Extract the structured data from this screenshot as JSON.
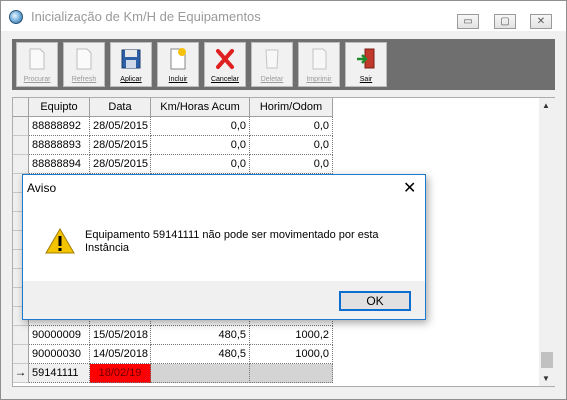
{
  "window": {
    "title": "Inicialização de Km/H de Equipamentos",
    "minimize": "▭",
    "restore": "▢",
    "close": "✕"
  },
  "toolbar": {
    "procurar": "Procurar",
    "refresh": "Refresh",
    "aplicar": "Aplicar",
    "incluir": "Incluir",
    "cancelar": "Cancelar",
    "deletar": "Deletar",
    "imprimir": "Imprimir",
    "sair": "Sair"
  },
  "grid": {
    "headers": [
      "Equipto",
      "Data",
      "Km/Horas Acum",
      "Horim/Odom"
    ],
    "rows_top": [
      [
        "88888892",
        "28/05/2015",
        "0,0",
        "0,0"
      ],
      [
        "88888893",
        "28/05/2015",
        "0,0",
        "0,0"
      ],
      [
        "88888894",
        "28/05/2015",
        "0,0",
        "0,0"
      ]
    ],
    "rows_bottom": [
      [
        "90000009",
        "15/05/2018",
        "480,5",
        "1000,2"
      ],
      [
        "90000030",
        "14/05/2018",
        "480,5",
        "1000,0"
      ],
      [
        "59141111",
        "18/02/19",
        "",
        ""
      ]
    ],
    "current_row_marker": "→",
    "scroll_up": "▲",
    "scroll_down": "▼"
  },
  "dialog": {
    "title": "Aviso",
    "close": "✕",
    "message": "Equipamento 59141111 não pode ser movimentado por esta Instância",
    "ok_label": "OK"
  },
  "colors": {
    "highlight_cell": "#ff0000",
    "toolbar_bg": "#6f6f6f",
    "dialog_border": "#1c7ad0"
  }
}
